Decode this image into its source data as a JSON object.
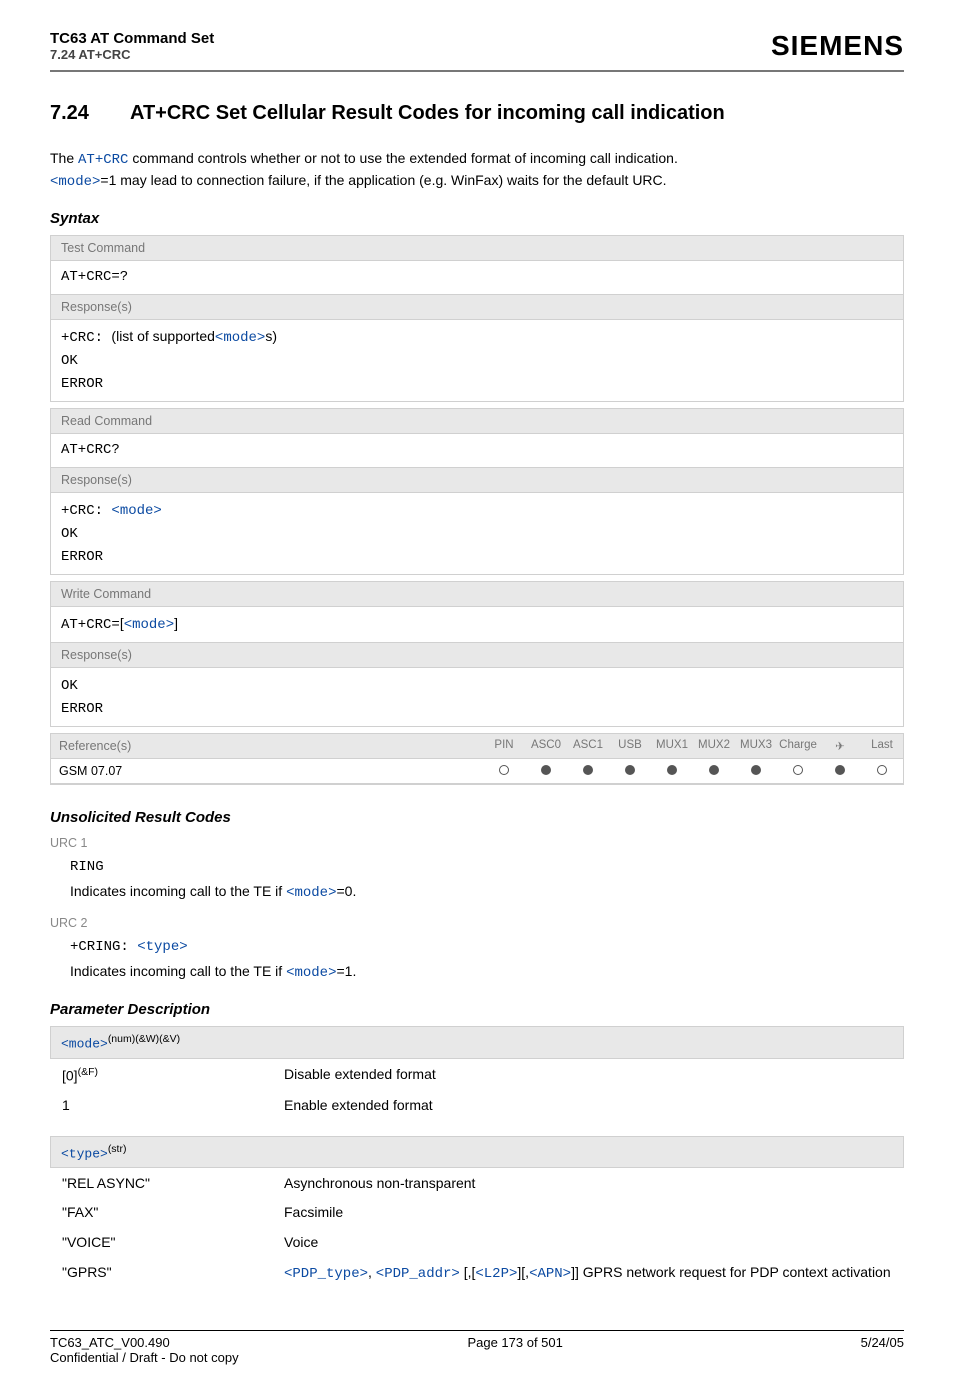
{
  "header": {
    "docTitle": "TC63 AT Command Set",
    "docSubtitle": "7.24 AT+CRC",
    "brand": "SIEMENS"
  },
  "section": {
    "num": "7.24",
    "title": "AT+CRC   Set Cellular Result Codes for incoming call indication"
  },
  "intro": {
    "part1": "The ",
    "cmd": "AT+CRC",
    "part2": " command controls whether or not to use the extended format of incoming call indication.",
    "modeLink": "<mode>",
    "part3": "=1 may lead to connection failure, if the application (e.g. WinFax) waits for the default URC."
  },
  "syntaxHeading": "Syntax",
  "testCmd": {
    "hdr": "Test Command",
    "cmd": "AT+CRC=?",
    "respHdr": "Response(s)",
    "respPrefix": "+CRC: ",
    "respList": "(list of supported",
    "respMode": "<mode>",
    "respSuffix": "s)",
    "ok": "OK",
    "error": "ERROR"
  },
  "readCmd": {
    "hdr": "Read Command",
    "cmd": "AT+CRC?",
    "respHdr": "Response(s)",
    "respPrefix": "+CRC: ",
    "respMode": "<mode>",
    "ok": "OK",
    "error": "ERROR"
  },
  "writeCmd": {
    "hdr": "Write Command",
    "cmdPrefix": "AT+CRC=",
    "bracket1": "[",
    "mode": "<mode>",
    "bracket2": "]",
    "respHdr": "Response(s)",
    "ok": "OK",
    "error": "ERROR"
  },
  "refTable": {
    "refHdr": "Reference(s)",
    "refVal": "GSM 07.07",
    "cols": [
      "PIN",
      "ASC0",
      "ASC1",
      "USB",
      "MUX1",
      "MUX2",
      "MUX3",
      "Charge",
      "✈",
      "Last"
    ],
    "dots": [
      "empty",
      "full",
      "full",
      "full",
      "full",
      "full",
      "full",
      "empty",
      "full",
      "empty"
    ]
  },
  "urcHeading": "Unsolicited Result Codes",
  "urc1": {
    "label": "URC 1",
    "code": "RING",
    "descPre": "Indicates incoming call to the TE if ",
    "mode": "<mode>",
    "descPost": "=0."
  },
  "urc2": {
    "label": "URC 2",
    "codePre": "+CRING: ",
    "type": "<type>",
    "descPre": "Indicates incoming call to the TE if ",
    "mode": "<mode>",
    "descPost": "=1."
  },
  "paramHeading": "Parameter Description",
  "paramMode": {
    "name": "<mode>",
    "sup": "(num)(&W)(&V)",
    "rows": [
      {
        "key": "[0]",
        "keySup": "(&F)",
        "desc": "Disable extended format"
      },
      {
        "key": "1",
        "keySup": "",
        "desc": "Enable extended format"
      }
    ]
  },
  "paramType": {
    "name": "<type>",
    "sup": "(str)",
    "rows": [
      {
        "key": "\"REL ASYNC\"",
        "desc": "Asynchronous non-transparent"
      },
      {
        "key": "\"FAX\"",
        "desc": "Facsimile"
      },
      {
        "key": "\"VOICE\"",
        "desc": "Voice"
      }
    ],
    "gprs": {
      "key": "\"GPRS\"",
      "p1": "<PDP_type>",
      "c1": ", ",
      "p2": "<PDP_addr>",
      "c2": " [,[",
      "p3": "<L2P>",
      "c3": "][,",
      "p4": "<APN>",
      "c4": "]] GPRS network request for PDP context activation"
    }
  },
  "footer": {
    "left": "TC63_ATC_V00.490",
    "center": "Page 173 of 501",
    "right": "5/24/05",
    "sub": "Confidential / Draft - Do not copy"
  }
}
